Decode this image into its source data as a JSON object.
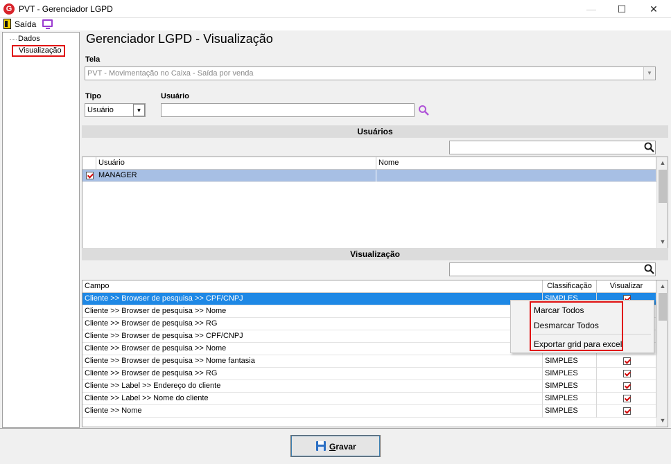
{
  "window": {
    "title": "PVT - Gerenciador LGPD",
    "minimize": "—",
    "maximize": "☐",
    "close": "✕"
  },
  "toolbar": {
    "exit_label": "Saída"
  },
  "tree": {
    "items": [
      "Dados",
      "Visualização"
    ]
  },
  "page_title": "Gerenciador LGPD - Visualização",
  "tela": {
    "label": "Tela",
    "value": "PVT - Movimentação no Caixa - Saída por venda"
  },
  "tipo": {
    "label": "Tipo",
    "value": "Usuário"
  },
  "usuario": {
    "label": "Usuário",
    "value": ""
  },
  "users_section": {
    "title": "Usuários",
    "search_value": "",
    "columns": [
      "Usuário",
      "Nome"
    ],
    "rows": [
      {
        "usuario": "MANAGER",
        "nome": "",
        "checked": true
      }
    ]
  },
  "view_section": {
    "title": "Visualização",
    "search_value": "",
    "columns": [
      "Campo",
      "Classificação",
      "Visualizar"
    ],
    "rows": [
      {
        "campo": "Cliente  >> Browser de pesquisa >> CPF/CNPJ",
        "classificacao": "SIMPLES",
        "visualizar": true
      },
      {
        "campo": "Cliente  >> Browser de pesquisa >> Nome",
        "classificacao": "SIMPLES",
        "visualizar": true
      },
      {
        "campo": "Cliente  >> Browser de pesquisa >> RG",
        "classificacao": "SIMPLES",
        "visualizar": true
      },
      {
        "campo": "Cliente >> Browser de pesquisa >> CPF/CNPJ",
        "classificacao": "SIMPLES",
        "visualizar": true
      },
      {
        "campo": "Cliente >> Browser de pesquisa >> Nome",
        "classificacao": "SIMPLES",
        "visualizar": true
      },
      {
        "campo": "Cliente >> Browser de pesquisa >> Nome fantasia",
        "classificacao": "SIMPLES",
        "visualizar": true
      },
      {
        "campo": "Cliente >> Browser de pesquisa >> RG",
        "classificacao": "SIMPLES",
        "visualizar": true
      },
      {
        "campo": "Cliente >> Label >> Endereço do cliente",
        "classificacao": "SIMPLES",
        "visualizar": true
      },
      {
        "campo": "Cliente >> Label >> Nome do cliente",
        "classificacao": "SIMPLES",
        "visualizar": true
      },
      {
        "campo": "Cliente >> Nome",
        "classificacao": "SIMPLES",
        "visualizar": true
      }
    ]
  },
  "context_menu": {
    "items": [
      "Marcar Todos",
      "Desmarcar Todos",
      "Exportar grid para excel"
    ]
  },
  "save_button": {
    "accel": "G",
    "rest": "ravar"
  },
  "colors": {
    "selection": "#1e88e5",
    "user_selection": "#a7bfe4",
    "highlight_red": "#e01010",
    "accent_purple": "#9b3bd0"
  },
  "icons": [
    "app-logo-icon",
    "exit-door-icon",
    "monitor-icon",
    "search-icon",
    "save-disk-icon",
    "chevron-down-icon",
    "check-icon"
  ]
}
